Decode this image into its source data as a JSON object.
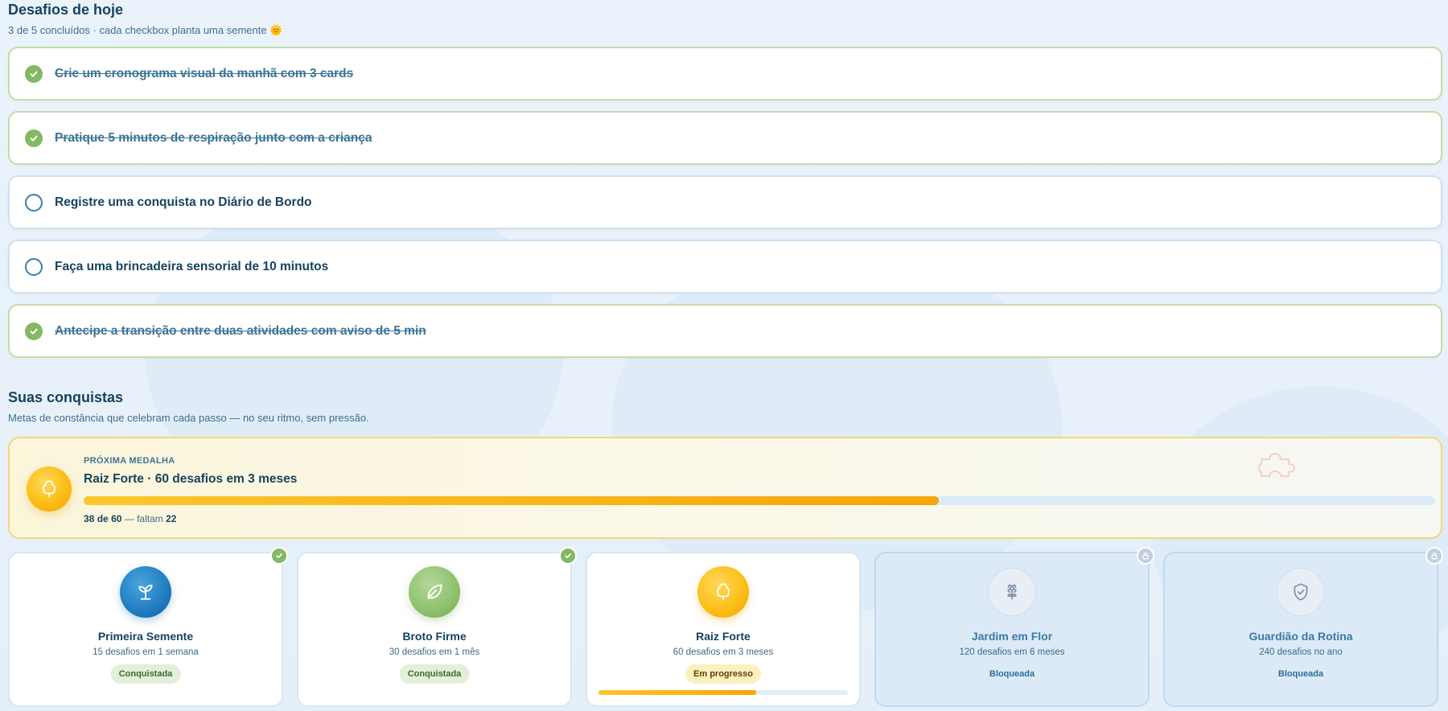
{
  "challenges": {
    "title": "Desafios de hoje",
    "subtitle": "3 de 5 concluídos · cada checkbox planta uma semente 🌞",
    "tasks": [
      {
        "text": "Crie um cronograma visual da manhã com 3 cards",
        "done": true
      },
      {
        "text": "Pratique 5 minutos de respiração junto com a criança",
        "done": true
      },
      {
        "text": "Registre uma conquista no Diário de Bordo",
        "done": false
      },
      {
        "text": "Faça uma brincadeira sensorial de 10 minutos",
        "done": false
      },
      {
        "text": "Antecipe a transição entre duas atividades com aviso de 5 min",
        "done": true
      }
    ]
  },
  "achievements": {
    "title": "Suas conquistas",
    "subtitle": "Metas de constância que celebram cada passo — no seu ritmo, sem pressão.",
    "next": {
      "eyebrow": "PRÓXIMA MEDALHA",
      "name": "Raiz Forte · 60 desafios em 3 meses",
      "current": "38",
      "total": "60",
      "remaining": "22",
      "count_prefix": "de",
      "count_sep": "— faltam",
      "progress_fraction": 0.633,
      "icon": "tree-icon"
    },
    "medals": [
      {
        "name": "Primeira Semente",
        "desc": "15 desafios em 1 semana",
        "status": "Conquistada",
        "state": "done",
        "icon": "sprout-icon",
        "color": "#1f7cc0"
      },
      {
        "name": "Broto Firme",
        "desc": "30 desafios em 1 mês",
        "status": "Conquistada",
        "state": "done",
        "icon": "leaf-icon",
        "color": "#8fc06c"
      },
      {
        "name": "Raiz Forte",
        "desc": "60 desafios em 3 meses",
        "status": "Em progresso",
        "state": "progress",
        "icon": "tree-icon",
        "color": "#fbbd14",
        "progress_fraction": 0.633
      },
      {
        "name": "Jardim em Flor",
        "desc": "120 desafios em 6 meses",
        "status": "Bloqueada",
        "state": "locked",
        "icon": "flower-icon"
      },
      {
        "name": "Guardião da Rotina",
        "desc": "240 desafios no ano",
        "status": "Bloqueada",
        "state": "locked",
        "icon": "shield-icon"
      }
    ]
  },
  "colors": {
    "primary_text": "#17435f",
    "success": "#84b862",
    "gold": "#fbbd14",
    "page_background": "#eaf3fb"
  }
}
